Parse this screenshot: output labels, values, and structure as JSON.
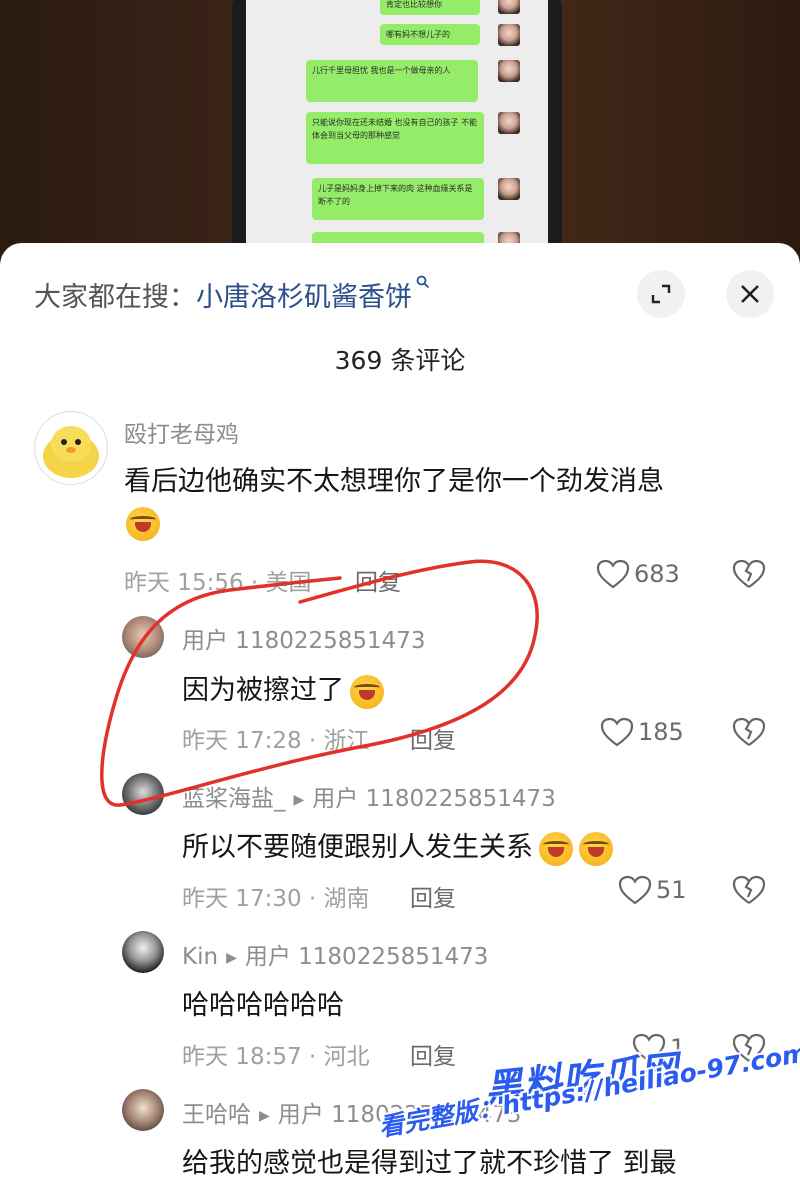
{
  "chat": {
    "messages": [
      {
        "text": "肯定也比较想你"
      },
      {
        "text": "哪有妈不想儿子的"
      },
      {
        "text": "儿行千里母担忧 我也是一个做母亲的人"
      },
      {
        "text": "只能说你现在还未结婚 也没有自己的孩子 不能体会到当父母的那种感觉"
      },
      {
        "text": "儿子是妈妈身上掉下来的肉 这种血缘关系是断不了的"
      }
    ]
  },
  "sheet": {
    "search_prefix": "大家都在搜：",
    "search_term": "小唐洛杉矶酱香饼",
    "search_icon": "search-icon",
    "minimize_icon": "collapse-icon",
    "close_icon": "close-icon",
    "comment_count": "369 条评论"
  },
  "comments": [
    {
      "name": "殴打老母鸡",
      "text": "看后边他确实不太想理你了是你一个劲发消息",
      "meta": "昨天 15:56 · 美国",
      "reply": "回复",
      "likes": "683"
    },
    {
      "name": "用户 1180225851473",
      "text": "因为被擦过了",
      "meta": "昨天 17:28 · 浙江",
      "reply": "回复",
      "likes": "185"
    },
    {
      "name": "蓝桨海盐_",
      "reply_to": "用户 1180225851473",
      "text": "所以不要随便跟别人发生关系",
      "meta": "昨天 17:30 · 湖南",
      "reply": "回复",
      "likes": "51"
    },
    {
      "name": "Kin",
      "reply_to": "用户 1180225851473",
      "text": "哈哈哈哈哈哈",
      "meta": "昨天 18:57 · 河北",
      "reply": "回复",
      "likes": "1"
    },
    {
      "name": "王哈哈",
      "reply_to": "用户 1180225851473",
      "text": "给我的感觉也是得到过了就不珍惜了 到最",
      "meta": "",
      "reply": "",
      "likes": ""
    }
  ],
  "watermark": {
    "brand": "黑料吃瓜网",
    "url": "看完整版：https://heiliao-97.com"
  },
  "colors": {
    "accent_link": "#2a4f8a",
    "bubble_green": "#95ec69",
    "annotation_red": "#e0322a",
    "watermark_blue": "#2b5cf0"
  }
}
